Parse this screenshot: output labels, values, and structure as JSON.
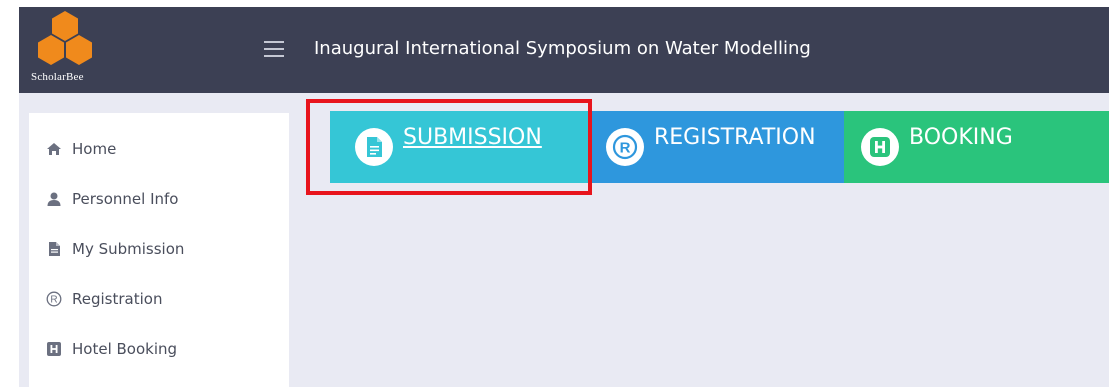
{
  "header": {
    "logo_text": "ScholarBee",
    "title": "Inaugural International Symposium on Water Modelling",
    "menu_icon": "hamburger-icon",
    "colors": {
      "bar": "#3c4054",
      "logo": "#f08a1c"
    }
  },
  "sidebar": {
    "items": [
      {
        "label": "Home",
        "icon": "home-icon"
      },
      {
        "label": "Personnel Info",
        "icon": "user-icon"
      },
      {
        "label": "My Submission",
        "icon": "document-icon"
      },
      {
        "label": "Registration",
        "icon": "registered-icon"
      },
      {
        "label": "Hotel Booking",
        "icon": "hotel-icon"
      }
    ]
  },
  "tiles": [
    {
      "label": "SUBMISSION",
      "icon": "document-icon",
      "color": "#35c6d6",
      "highlighted": true
    },
    {
      "label": "REGISTRATION",
      "icon": "registered-icon",
      "color": "#2e97dd"
    },
    {
      "label": "BOOKING",
      "icon": "hotel-icon",
      "color": "#2ac47c"
    }
  ]
}
